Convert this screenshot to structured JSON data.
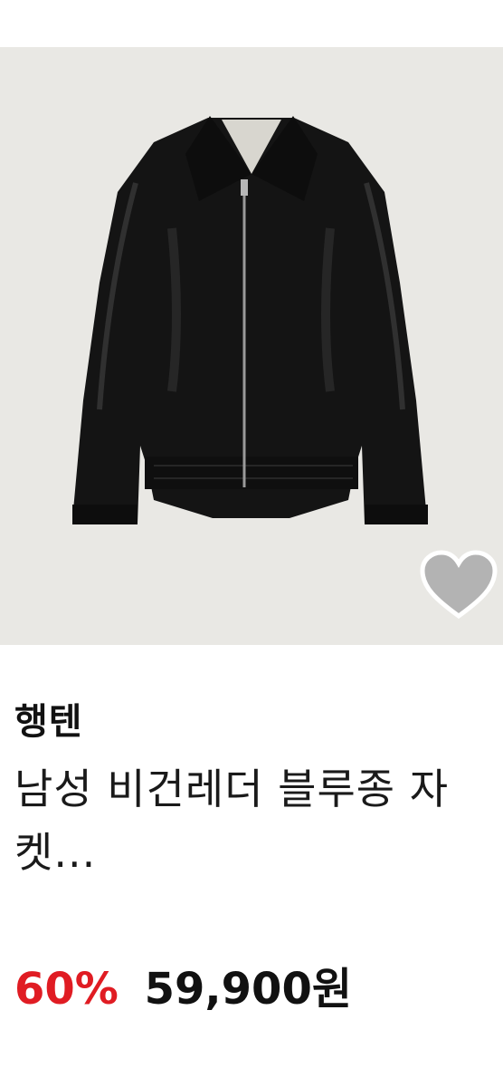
{
  "product": {
    "image_icon": "leather-jacket-image",
    "wishlist_icon": "heart-icon",
    "brand": "행텐",
    "title": "남성 비건레더 블루종 자켓...",
    "discount": "60%",
    "price": "59,900원",
    "colors": {
      "background": "#e9e8e4",
      "discount": "#e01c23",
      "heart": "#b3b3b3"
    }
  }
}
